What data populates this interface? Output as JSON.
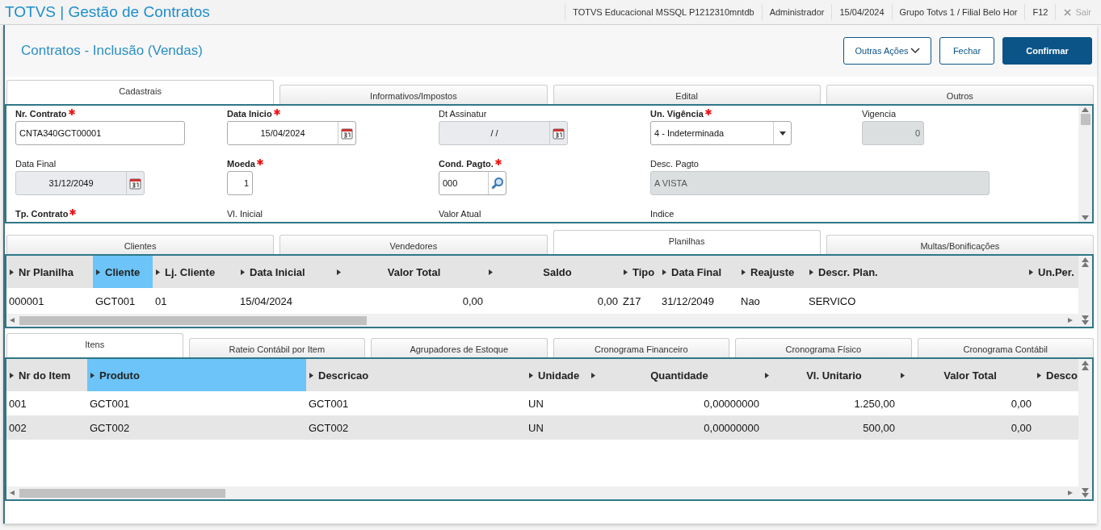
{
  "topbar": {
    "title": "TOTVS | Gestão de Contratos",
    "info": [
      "TOTVS Educacional MSSQL P1212310mntdb",
      "Administrador",
      "15/04/2024",
      "Grupo Totvs 1 / Filial Belo Hor",
      "F12"
    ],
    "exit": {
      "label": "Sair",
      "disabled": true
    }
  },
  "header": {
    "title": "Contratos - Inclusão (Vendas)",
    "buttons": [
      {
        "label": "Outras Ações",
        "kind": "menu"
      },
      {
        "label": "Fechar",
        "kind": "secondary"
      },
      {
        "label": "Confirmar",
        "kind": "primary"
      }
    ]
  },
  "form_tabs": [
    {
      "label": "Cadastrais",
      "selected": true
    },
    {
      "label": "Informativos/Impostos",
      "selected": false
    },
    {
      "label": "Edital",
      "selected": false
    },
    {
      "label": "Outros",
      "selected": false
    }
  ],
  "fields": [
    {
      "label": "Nr. Contrato",
      "required": true,
      "value": "CNTA340GCT00001",
      "kind": "text",
      "disabled": false
    },
    {
      "label": "Data Inicio",
      "required": true,
      "value": "15/04/2024",
      "kind": "date",
      "disabled": false
    },
    {
      "label": "Dt Assinatur",
      "required": false,
      "value": "/ /",
      "kind": "date",
      "disabled": true
    },
    {
      "label": "Un. Vigência",
      "required": true,
      "value": "4 - Indeterminada",
      "kind": "select",
      "disabled": false
    },
    {
      "label": "Vigencia",
      "required": false,
      "value": "0",
      "kind": "number",
      "disabled": true
    },
    {
      "label": "Data Final",
      "required": false,
      "value": "31/12/2049",
      "kind": "date",
      "disabled": true
    },
    {
      "label": "Moeda",
      "required": true,
      "value": "1",
      "kind": "number",
      "disabled": false
    },
    {
      "label": "Cond. Pagto.",
      "required": true,
      "value": "000",
      "kind": "lookup",
      "disabled": false
    },
    {
      "label": "Desc. Pagto",
      "required": false,
      "value": "A VISTA",
      "kind": "text",
      "disabled": true
    },
    {
      "label": "Tp. Contrato",
      "required": true,
      "kind": "cut"
    },
    {
      "label": "Vl. Inicial",
      "required": false,
      "kind": "cut"
    },
    {
      "label": "Valor Atual",
      "required": false,
      "kind": "cut"
    },
    {
      "label": "Indice",
      "required": false,
      "kind": "cut"
    }
  ],
  "sheet_tabs": [
    {
      "label": "Clientes",
      "selected": false
    },
    {
      "label": "Vendedores",
      "selected": false
    },
    {
      "label": "Planilhas",
      "selected": true
    },
    {
      "label": "Multas/Bonificações",
      "selected": false
    }
  ],
  "sheets_table": {
    "columns": [
      {
        "label": "Nr Planilha",
        "selected": false
      },
      {
        "label": "Cliente",
        "selected": true
      },
      {
        "label": "Lj. Cliente",
        "selected": false
      },
      {
        "label": "Data Inicial",
        "selected": false
      },
      {
        "label": "Valor Total",
        "selected": false
      },
      {
        "label": "Saldo",
        "selected": false
      },
      {
        "label": "Tipo",
        "selected": false
      },
      {
        "label": "Data Final",
        "selected": false
      },
      {
        "label": "Reajuste",
        "selected": false
      },
      {
        "label": "Descr. Plan.",
        "selected": false
      },
      {
        "label": "Un.Per.",
        "selected": false
      }
    ],
    "rows": [
      [
        "000001",
        "GCT001",
        "01",
        "15/04/2024",
        "0,00",
        "0,00",
        "Z17",
        "31/12/2049",
        "Nao",
        "SERVICO",
        ""
      ]
    ]
  },
  "item_tabs": [
    {
      "label": "Itens",
      "selected": true
    },
    {
      "label": "Rateio Contábil por Item",
      "selected": false
    },
    {
      "label": "Agrupadores de Estoque",
      "selected": false
    },
    {
      "label": "Cronograma Financeiro",
      "selected": false
    },
    {
      "label": "Cronograma Físico",
      "selected": false
    },
    {
      "label": "Cronograma Contábil",
      "selected": false
    }
  ],
  "items_table": {
    "columns": [
      {
        "label": "Nr do Item",
        "selected": false
      },
      {
        "label": "Produto",
        "selected": true
      },
      {
        "label": "Descricao",
        "selected": false
      },
      {
        "label": "Unidade",
        "selected": false
      },
      {
        "label": "Quantidade",
        "selected": false
      },
      {
        "label": "Vl. Unitario",
        "selected": false
      },
      {
        "label": "Valor Total",
        "selected": false
      },
      {
        "label": "Desco",
        "selected": false
      }
    ],
    "rows": [
      [
        "001",
        "GCT001",
        "GCT001",
        "UN",
        "0,00000000",
        "1.250,00",
        "0,00",
        ""
      ],
      [
        "002",
        "GCT002",
        "GCT002",
        "UN",
        "0,00000000",
        "500,00",
        "0,00",
        ""
      ]
    ]
  }
}
